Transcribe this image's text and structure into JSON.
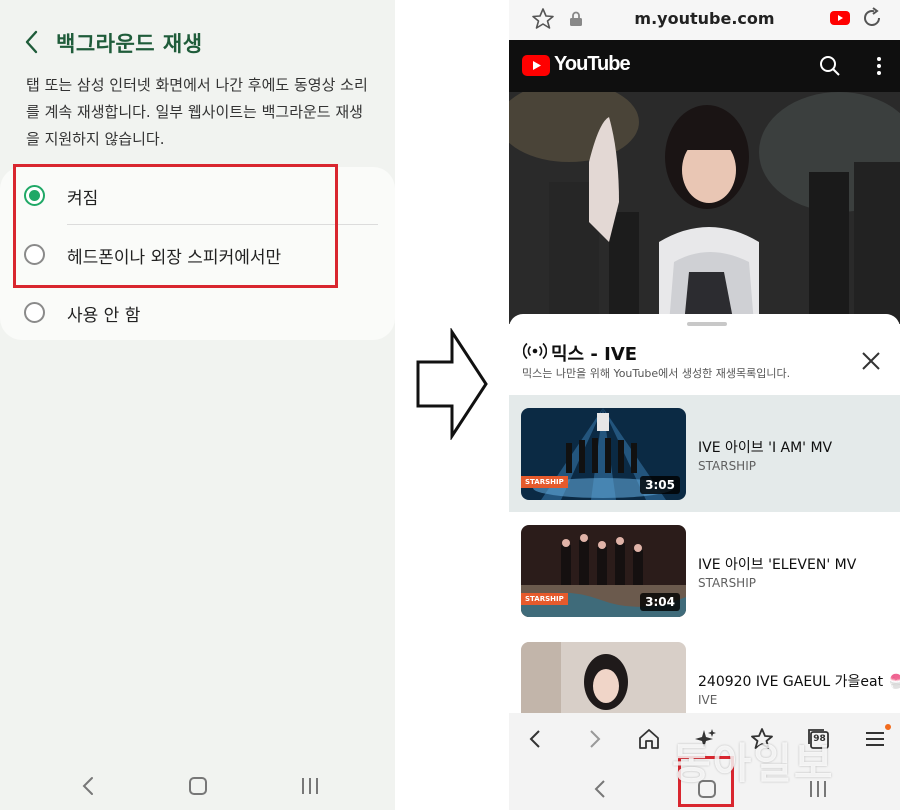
{
  "left": {
    "title": "백그라운드 재생",
    "description": "탭 또는 삼성 인터넷 화면에서 나간 후에도 동영상 소리를 계속 재생합니다. 일부 웹사이트는 백그라운드 재생을 지원하지 않습니다.",
    "options": [
      {
        "label": "켜짐",
        "selected": true
      },
      {
        "label": "헤드폰이나 외장 스피커에서만",
        "selected": false
      },
      {
        "label": "사용 안 함",
        "selected": false
      }
    ]
  },
  "right": {
    "url": "m.youtube.com",
    "youtube_word": "YouTube",
    "mix_title": "믹스 - IVE",
    "mix_subtitle": "믹스는 나만을 위해 YouTube에서 생성한 재생목록입니다.",
    "playlist": [
      {
        "title": "IVE 아이브 'I AM' MV",
        "channel": "STARSHIP",
        "duration": "3:05",
        "active": true
      },
      {
        "title": "IVE 아이브 'ELEVEN' MV",
        "channel": "STARSHIP",
        "duration": "3:04",
        "active": false
      },
      {
        "title": "240920 IVE GAEUL 가을eat 🍧",
        "channel": "IVE",
        "duration": "",
        "active": false
      }
    ],
    "tab_count": "98",
    "starship_label": "STARSHIP"
  },
  "watermark": "동아일보",
  "colors": {
    "accent_green": "#1fa866",
    "title_green": "#1f5c3a",
    "highlight_red": "#d9262f",
    "youtube_red": "#ff0000",
    "active_row": "#e4eaea"
  }
}
